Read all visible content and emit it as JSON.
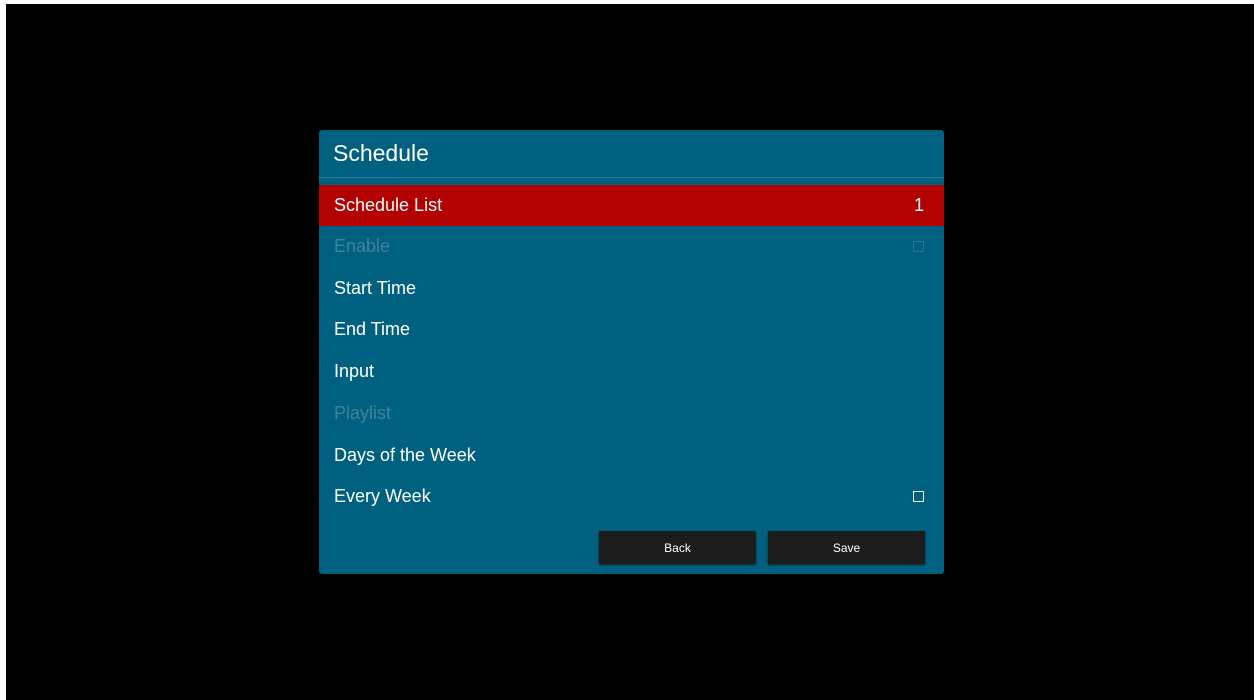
{
  "dialog": {
    "title": "Schedule",
    "rows": [
      {
        "label": "Schedule List",
        "value": "1",
        "state": "selected"
      },
      {
        "label": "Enable",
        "control": "checkbox",
        "checked": false,
        "state": "disabled"
      },
      {
        "label": "Start Time",
        "state": "normal"
      },
      {
        "label": "End Time",
        "state": "normal"
      },
      {
        "label": "Input",
        "state": "normal"
      },
      {
        "label": "Playlist",
        "state": "disabled"
      },
      {
        "label": "Days of the Week",
        "state": "normal"
      },
      {
        "label": "Every Week",
        "control": "checkbox",
        "checked": false,
        "state": "normal"
      }
    ],
    "buttons": {
      "back_label": "Back",
      "save_label": "Save"
    }
  },
  "colors": {
    "background": "#000000",
    "dialog": "#00607f",
    "selected_row": "#b30000",
    "disabled_text": "#3f839b",
    "button": "#1c1c1c"
  }
}
